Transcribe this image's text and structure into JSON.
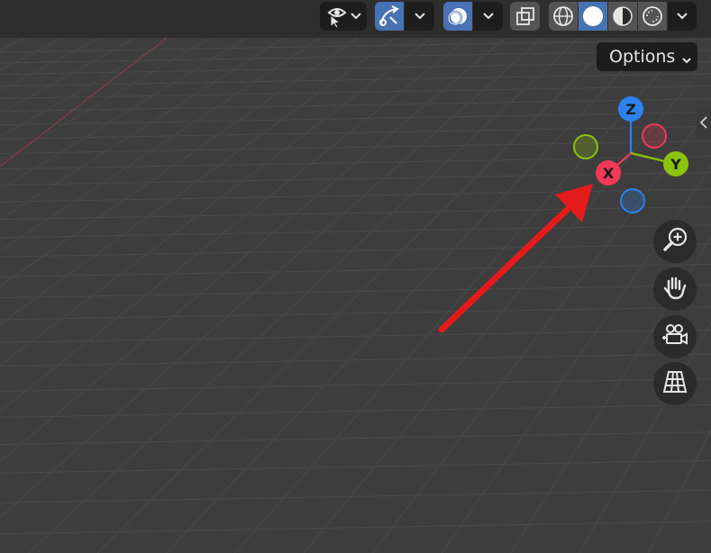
{
  "header": {
    "options_label": "Options"
  },
  "gizmo": {
    "x_label": "X",
    "y_label": "Y",
    "z_label": "Z"
  },
  "icons": {
    "visibility": "eye-selectable-icon",
    "gizmo": "gizmo-arrow-icon",
    "overlays": "overlays-icon",
    "xray": "xray-toggle-icon",
    "wireframe": "wireframe-shading-icon",
    "solid": "solid-shading-icon",
    "material": "material-preview-icon",
    "rendered": "rendered-shading-icon",
    "zoom": "zoom-icon",
    "pan": "hand-pan-icon",
    "camera": "camera-view-icon",
    "ortho": "perspective-ortho-icon"
  },
  "colors": {
    "background": "#3d3d3d",
    "grid": "#484848",
    "x_axis": "#f03a57",
    "y_axis": "#8bc20b",
    "z_axis": "#2c82f0",
    "active_button": "#4772b3",
    "annotation_arrow": "#e51a1a"
  }
}
